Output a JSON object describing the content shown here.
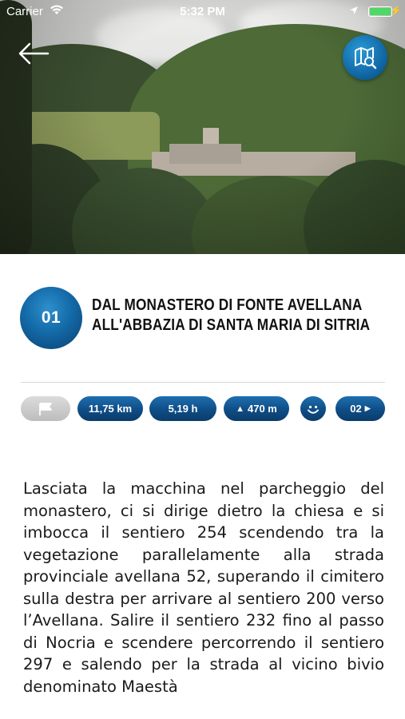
{
  "status_bar": {
    "carrier": "Carrier",
    "time": "5:32 PM",
    "wifi_icon": "wifi-icon",
    "location_icon": "location-arrow-icon",
    "battery_level": 1.0,
    "battery_color": "#4cd964"
  },
  "nav": {
    "back_icon": "arrow-left-icon",
    "map_icon": "map-search-icon"
  },
  "route": {
    "number": "01",
    "title": "DAL MONASTERO DI FONTE AVELLANA ALL'ABBAZIA DI SANTA MARIA DI SITRIA"
  },
  "info_pills": {
    "flag_icon": "flag-icon",
    "distance": "11,75 km",
    "duration": "5,19 h",
    "elevation": "470 m",
    "elevation_icon": "triangle-up-icon",
    "difficulty_icon": "smile-icon",
    "next_route": "02"
  },
  "description": "Lasciata la macchina nel parcheggio del monastero, ci si dirige dietro la chiesa e si imbocca il sentiero 254 scendendo tra la vegetazione parallelamente alla strada provinciale avellana 52, superando il cimitero sulla destra per arrivare al sentiero 200 verso l’Avellana. Salire il sentiero 232 fino al passo di Nocria e scendere percorrendo il sentiero 297 e salendo per la strada al vicino bivio denominato Maestà",
  "colors": {
    "accent": "#0f4d86",
    "accent_light": "#2e8fcc"
  }
}
